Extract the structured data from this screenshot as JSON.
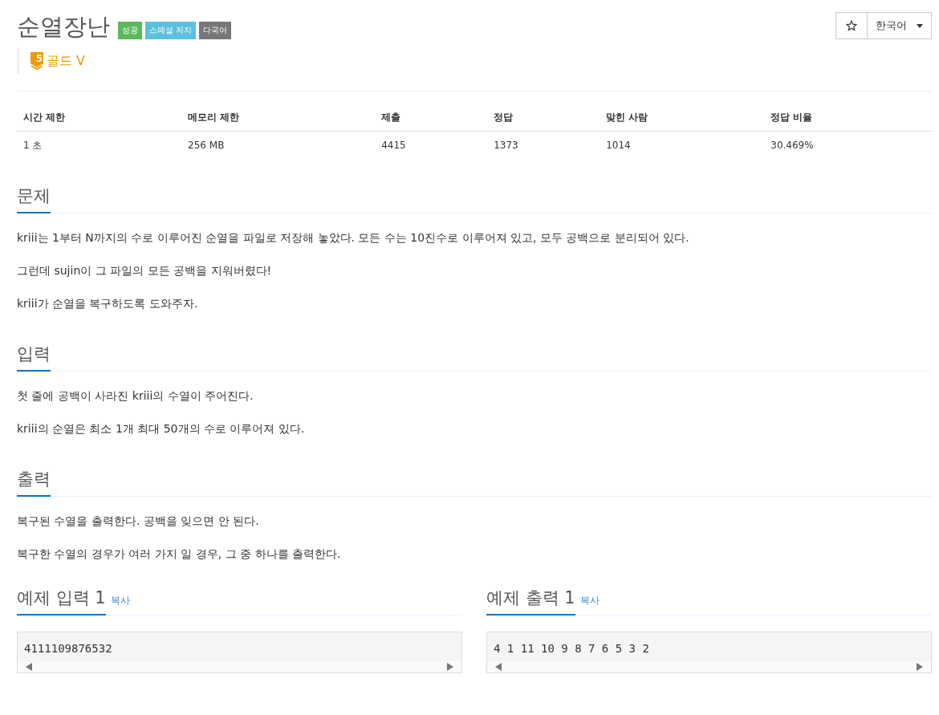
{
  "title": "순열장난",
  "badges": [
    {
      "label": "성공",
      "color": "#5cb85c"
    },
    {
      "label": "스페셜 저지",
      "color": "#5bc0de"
    },
    {
      "label": "다국어",
      "color": "#777777"
    }
  ],
  "tier": {
    "number": "5",
    "label": "골드 V"
  },
  "language": {
    "label": "한국어"
  },
  "stats": {
    "columns": [
      "시간 제한",
      "메모리 제한",
      "제출",
      "정답",
      "맞힌 사람",
      "정답 비율"
    ],
    "row": [
      "1 초",
      "256 MB",
      "4415",
      "1373",
      "1014",
      "30.469%"
    ]
  },
  "sections": [
    {
      "heading": "문제",
      "paragraphs": [
        "kriii는 1부터 N까지의 수로 이루어진 순열을 파일로 저장해 놓았다. 모든 수는 10진수로 이루어져 있고, 모두 공백으로 분리되어 있다.",
        "그런데 sujin이 그 파일의 모든 공백을 지워버렸다!",
        "kriii가 순열을 복구하도록 도와주자."
      ]
    },
    {
      "heading": "입력",
      "paragraphs": [
        "첫 줄에 공백이 사라진 kriii의 수열이 주어진다.",
        "kriii의 순열은 최소 1개 최대 50개의 수로 이루어져 있다."
      ]
    },
    {
      "heading": "출력",
      "paragraphs": [
        "복구된 수열을 출력한다. 공백을 잊으면 안 된다.",
        "복구한 수열의 경우가 여러 가지 일 경우, 그 중 하나를 출력한다."
      ]
    }
  ],
  "samples": [
    {
      "heading": "예제 입력 1",
      "copy": "복사",
      "content": "4111109876532"
    },
    {
      "heading": "예제 출력 1",
      "copy": "복사",
      "content": "4 1 11 10 9 8 7 6 5 3 2"
    }
  ]
}
